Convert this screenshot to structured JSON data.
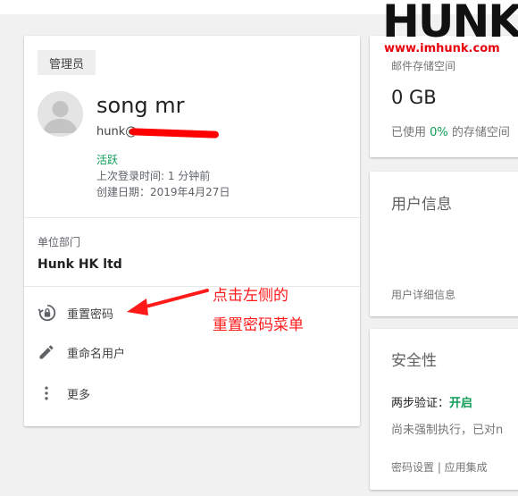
{
  "user_card": {
    "role_chip": "管理员",
    "name": "song mr",
    "email": "hunk@",
    "status": "活跃",
    "last_login": "上次登录时间: 1 分钟前",
    "created": "创建日期：2019年4月27日",
    "dept_label": "单位部门",
    "dept_value": "Hunk HK ltd",
    "actions": [
      {
        "label": "重置密码",
        "icon": "lock-reset-icon"
      },
      {
        "label": "重命名用户",
        "icon": "pencil-icon"
      },
      {
        "label": "更多",
        "icon": "more-vert-icon"
      }
    ]
  },
  "annotation": {
    "line1": "点击左侧的",
    "line2": "重置密码菜单",
    "color": "#ff1a1a"
  },
  "storage_card": {
    "title": "邮件存储空间",
    "value": "0 GB",
    "used_prefix": "已使用 ",
    "used_pct": "0%",
    "used_suffix": " 的存储空间"
  },
  "userinfo_card": {
    "title": "用户信息",
    "link": "用户详细信息"
  },
  "security_card": {
    "title": "安全性",
    "twofa_label": "两步验证：",
    "twofa_value": "开启",
    "note": "尚未强制执行，已对n",
    "links": "密码设置 | 应用集成"
  },
  "logo": {
    "word": "HUNK",
    "url": "www.imhunk.com"
  },
  "colors": {
    "accent_green": "#0f9d58",
    "annotation_red": "#ff1a1a",
    "logo_red": "#e8000b"
  }
}
